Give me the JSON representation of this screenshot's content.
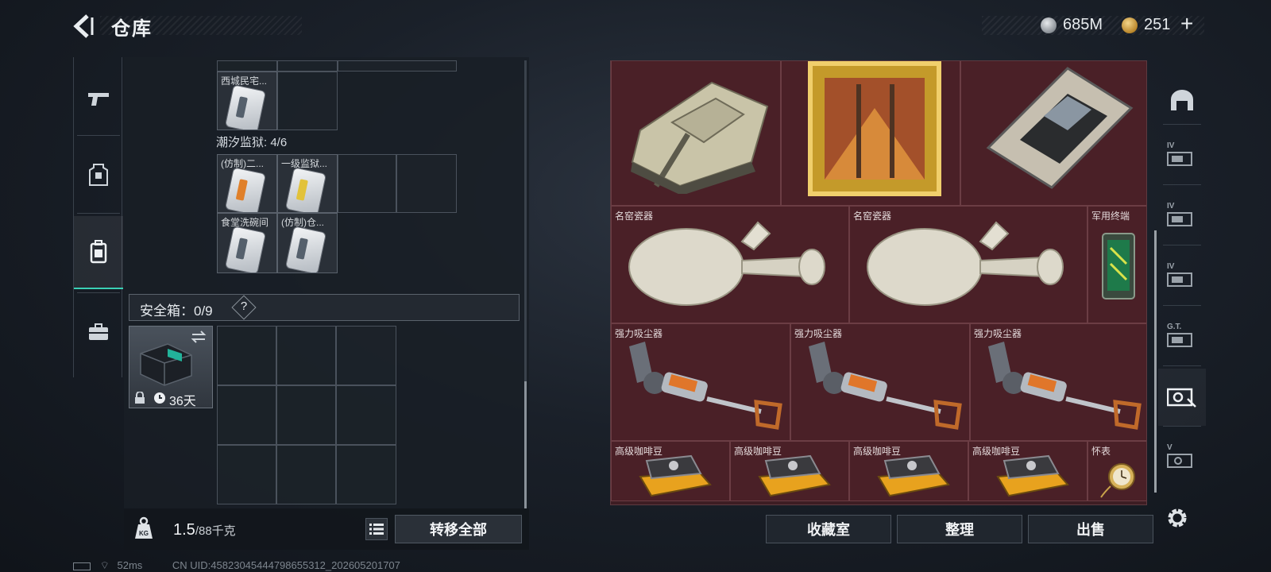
{
  "header": {
    "title": "仓库",
    "currency_1": "685M",
    "currency_2": "251",
    "currency_2_add": "+"
  },
  "left_nav": [
    {
      "icon": "pistol-icon"
    },
    {
      "icon": "armor-vest-icon"
    },
    {
      "icon": "backpack-icon"
    },
    {
      "icon": "briefcase-icon"
    }
  ],
  "left_panel": {
    "top_row_items": [
      {
        "label": "西城民宅..."
      }
    ],
    "prison_title": "潮汐监狱: 4/6",
    "prison_items": [
      {
        "label": "(仿制)二...",
        "variant": "orange"
      },
      {
        "label": "一级监狱...",
        "variant": "yellow"
      },
      {
        "label": "食堂洗碗间",
        "variant": "plain"
      },
      {
        "label": "(仿制)仓...",
        "variant": "plain"
      }
    ],
    "safebox_title": "安全箱：0/9",
    "safebox_help": "?",
    "safebox_item_timer": "36天"
  },
  "weight": {
    "current": "1.5",
    "max": "/88千克"
  },
  "buttons": {
    "transfer_all": "转移全部",
    "collection_room": "收藏室",
    "organize": "整理",
    "sell": "出售"
  },
  "right_panel": {
    "top_items": [
      {
        "icon": "tank-icon"
      },
      {
        "icon": "painting-icon"
      },
      {
        "icon": "circuit-board-icon"
      }
    ],
    "items": [
      {
        "label": "名窑瓷器",
        "icon": "porcelain-vase-icon"
      },
      {
        "label": "名窑瓷器",
        "icon": "porcelain-vase-icon"
      },
      {
        "label": "军用终端",
        "icon": "military-terminal-icon"
      },
      {
        "label": "强力吸尘器",
        "icon": "vacuum-cleaner-icon"
      },
      {
        "label": "强力吸尘器",
        "icon": "vacuum-cleaner-icon"
      },
      {
        "label": "强力吸尘器",
        "icon": "vacuum-cleaner-icon"
      },
      {
        "label": "高级咖啡豆",
        "icon": "coffee-beans-icon"
      },
      {
        "label": "高级咖啡豆",
        "icon": "coffee-beans-icon"
      },
      {
        "label": "高级咖啡豆",
        "icon": "coffee-beans-icon"
      },
      {
        "label": "高级咖啡豆",
        "icon": "coffee-beans-icon"
      },
      {
        "label": "怀表",
        "icon": "pocket-watch-icon"
      }
    ]
  },
  "right_nav": [
    {
      "icon": "storage-arch-icon",
      "tag": ""
    },
    {
      "icon": "storage-tab-icon",
      "tag": "IV"
    },
    {
      "icon": "storage-tab-icon",
      "tag": "IV"
    },
    {
      "icon": "storage-tab-icon",
      "tag": "IV"
    },
    {
      "icon": "storage-tab-icon",
      "tag": "G.T."
    },
    {
      "icon": "storage-tab-icon",
      "tag": ""
    },
    {
      "icon": "storage-tab-icon",
      "tag": "V"
    }
  ],
  "status": {
    "ping": "52ms",
    "uid": "CN UID:45823045444798655312_202605201707"
  },
  "colors": {
    "accent": "#3ad1b5",
    "item_bg_red": "#4a2027",
    "panel_bg": "#1e242c"
  }
}
